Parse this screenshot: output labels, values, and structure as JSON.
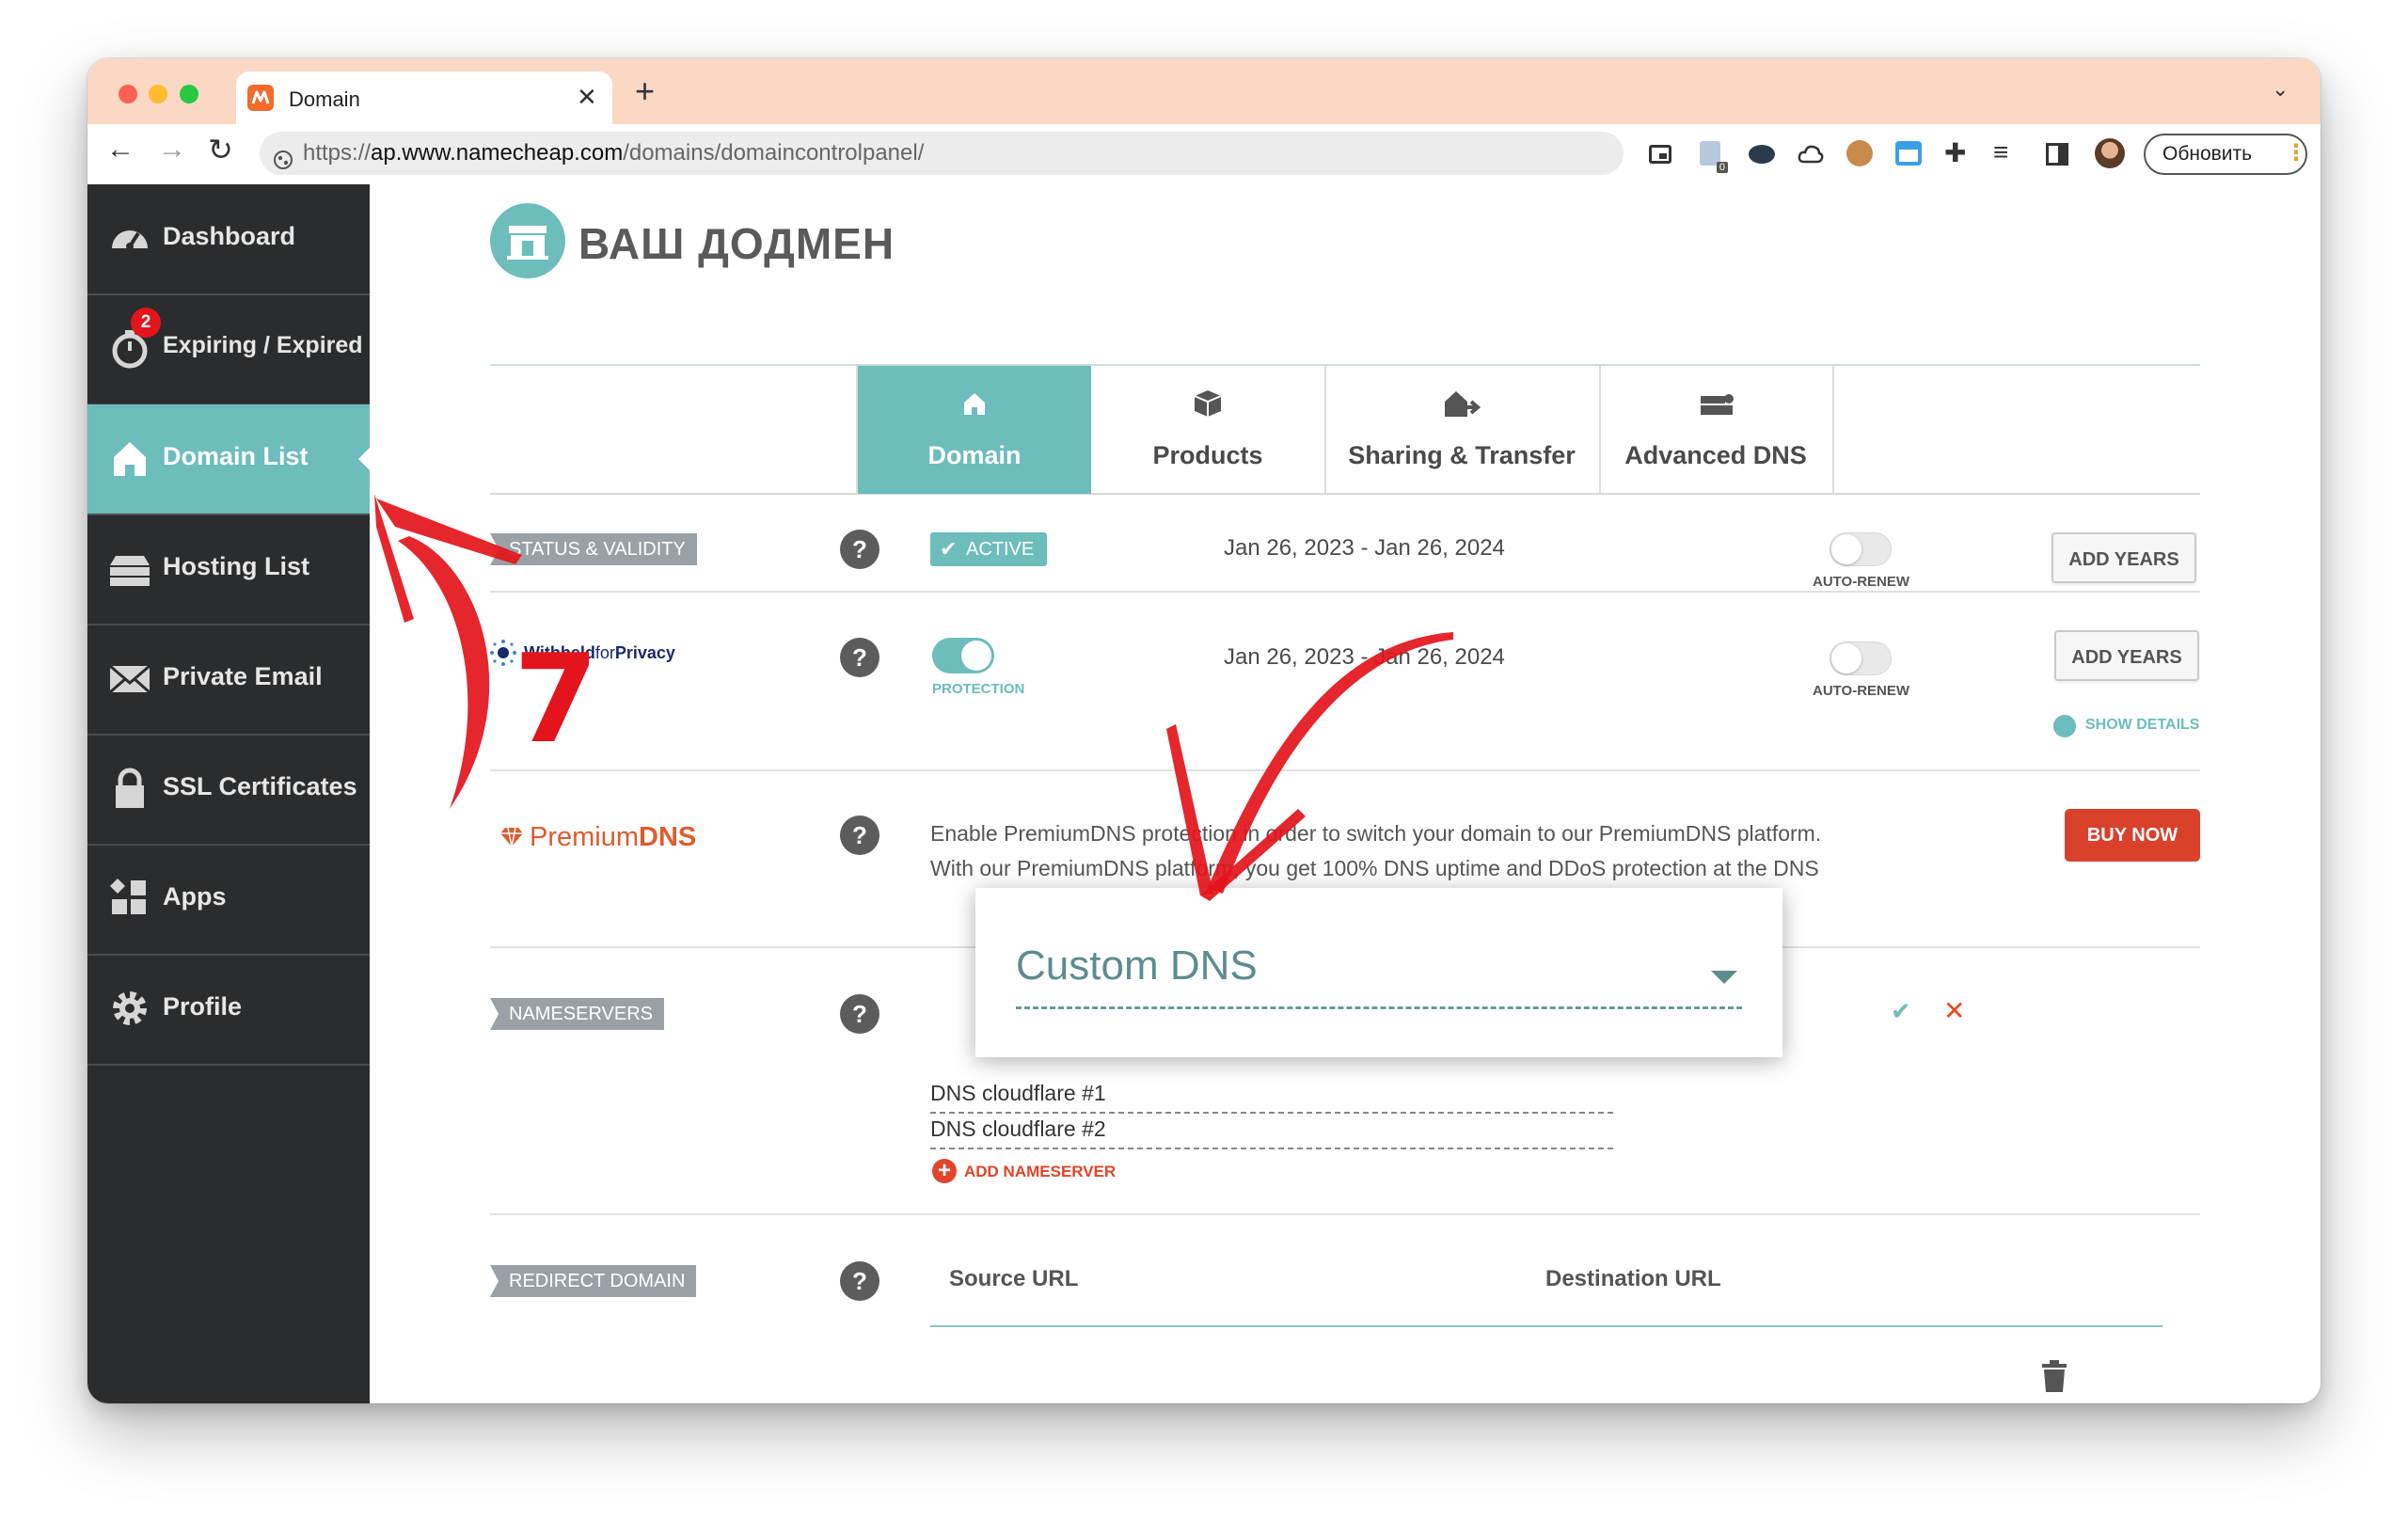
{
  "browser": {
    "tab_title": "Domain",
    "url_prefix": "https://",
    "url_host": "ap.www.namecheap.com",
    "url_path": "/domains/domaincontrolpanel/",
    "update_button": "Обновить",
    "extension_badge": "0"
  },
  "sidebar": {
    "items": [
      {
        "label": "Dashboard",
        "icon": "speedometer-icon"
      },
      {
        "label": "Expiring / Expired",
        "icon": "stopwatch-icon",
        "badge": "2"
      },
      {
        "label": "Domain List",
        "icon": "home-icon"
      },
      {
        "label": "Hosting List",
        "icon": "server-icon"
      },
      {
        "label": "Private Email",
        "icon": "envelope-icon"
      },
      {
        "label": "SSL Certificates",
        "icon": "lock-icon"
      },
      {
        "label": "Apps",
        "icon": "apps-icon"
      },
      {
        "label": "Profile",
        "icon": "gear-icon"
      }
    ]
  },
  "header": {
    "title": "ВАШ ДОДМЕН"
  },
  "tabs": [
    {
      "label": "Domain",
      "icon": "home-icon"
    },
    {
      "label": "Products",
      "icon": "box-icon"
    },
    {
      "label": "Sharing & Transfer",
      "icon": "transfer-icon"
    },
    {
      "label": "Advanced DNS",
      "icon": "router-icon"
    }
  ],
  "status": {
    "tag": "STATUS & VALIDITY",
    "badge": "ACTIVE",
    "dates": "Jan 26, 2023 - Jan 26, 2024",
    "auto_renew": "AUTO-RENEW",
    "add_years": "ADD YEARS"
  },
  "privacy": {
    "logo_a": "Withheld",
    "logo_b": "for",
    "logo_c": "Privacy",
    "protection": "PROTECTION",
    "dates": "Jan 26, 2023 - Jan 26, 2024",
    "auto_renew": "AUTO-RENEW",
    "add_years": "ADD YEARS",
    "show_details": "SHOW DETAILS"
  },
  "premium": {
    "logo_a": "Premium",
    "logo_b": "DNS",
    "line1": "Enable PremiumDNS protection in order to switch your domain to our PremiumDNS platform.",
    "line2": "With our PremiumDNS platform, you get 100% DNS uptime and DDoS protection at the DNS",
    "buy_now": "BUY NOW"
  },
  "nameservers": {
    "tag": "NAMESERVERS",
    "selected": "Custom DNS",
    "ns1": "DNS cloudflare #1",
    "ns2": "DNS cloudflare #2",
    "add": "ADD NAMESERVER"
  },
  "redirect": {
    "tag": "REDIRECT DOMAIN",
    "col_source": "Source URL",
    "col_dest": "Destination URL"
  },
  "annotation": {
    "step": "7"
  },
  "colors": {
    "teal": "#6cbdbb",
    "sidebar": "#2b2c2d",
    "orange": "#de5c2f",
    "red_button": "#d9412b",
    "annotation_red": "#e3141b"
  }
}
